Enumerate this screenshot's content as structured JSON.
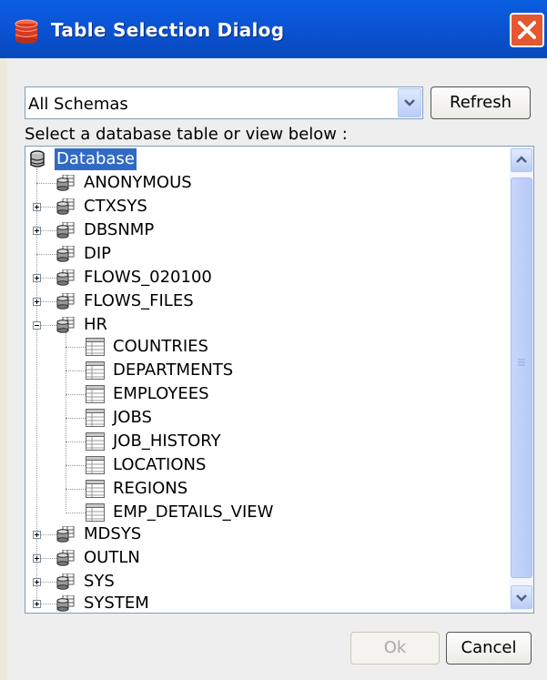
{
  "window": {
    "title": "Table Selection Dialog"
  },
  "schema_select": {
    "value": "All Schemas"
  },
  "buttons": {
    "refresh": "Refresh",
    "ok": "Ok",
    "cancel": "Cancel"
  },
  "prompt": "Select a database table or view below :",
  "tree": {
    "root": "Database",
    "schemas": [
      "ANONYMOUS",
      "CTXSYS",
      "DBSNMP",
      "DIP",
      "FLOWS_020100",
      "FLOWS_FILES",
      "HR"
    ],
    "hr_tables": [
      "COUNTRIES",
      "DEPARTMENTS",
      "EMPLOYEES",
      "JOBS",
      "JOB_HISTORY",
      "LOCATIONS",
      "REGIONS",
      "EMP_DETAILS_VIEW"
    ],
    "schemas_after": [
      "MDSYS",
      "OUTLN",
      "SYS",
      "SYSTEM"
    ]
  }
}
